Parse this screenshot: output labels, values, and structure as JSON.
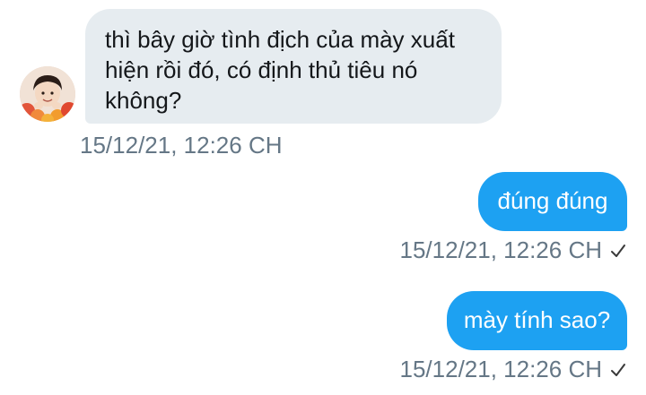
{
  "conversation": {
    "messages": [
      {
        "direction": "incoming",
        "text": "thì bây giờ tình địch của mày xuất hiện rồi đó, có định thủ tiêu nó không?",
        "timestamp": "15/12/21, 12:26 CH"
      },
      {
        "direction": "outgoing",
        "text": "đúng đúng",
        "timestamp": "15/12/21, 12:26 CH",
        "status_icon": "checkmark-icon"
      },
      {
        "direction": "outgoing",
        "text": "mày tính sao?",
        "timestamp": "15/12/21, 12:26 CH",
        "status_icon": "checkmark-icon"
      }
    ]
  },
  "colors": {
    "incoming_bubble": "#e6ecf0",
    "outgoing_bubble": "#1da1f2",
    "timestamp_text": "#657786"
  }
}
